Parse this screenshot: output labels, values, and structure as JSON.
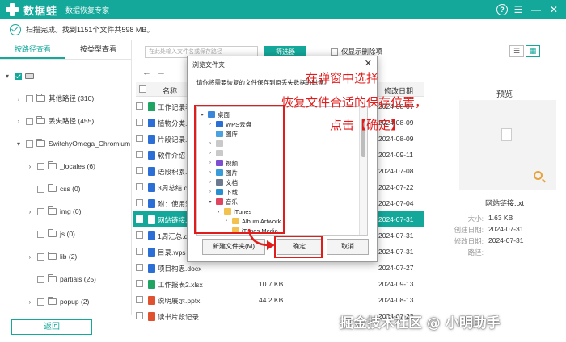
{
  "app": {
    "name": "数据蛙",
    "subtitle": "数据恢复专家"
  },
  "scan": {
    "status": "扫描完成。找到1151个文件共598 MB。"
  },
  "left_panel": {
    "tabs": [
      {
        "label": "按路径查看",
        "active": true
      },
      {
        "label": "按类型查看",
        "active": false
      }
    ],
    "tree": [
      {
        "label": "",
        "indent": 0,
        "caret": "▾",
        "drive": true,
        "checked": true
      },
      {
        "label": "其他路径 (310)",
        "indent": 1,
        "caret": "›"
      },
      {
        "label": "丢失路径 (455)",
        "indent": 1,
        "caret": "›"
      },
      {
        "label": "SwitchyOmega_Chromium",
        "indent": 1,
        "caret": "▾"
      },
      {
        "label": "_locales (6)",
        "indent": 2,
        "caret": "›"
      },
      {
        "label": "css (0)",
        "indent": 2,
        "caret": ""
      },
      {
        "label": "img (0)",
        "indent": 2,
        "caret": "›"
      },
      {
        "label": "js (0)",
        "indent": 2,
        "caret": ""
      },
      {
        "label": "lib (2)",
        "indent": 2,
        "caret": "›"
      },
      {
        "label": "partials (25)",
        "indent": 2,
        "caret": ""
      },
      {
        "label": "popup (2)",
        "indent": 2,
        "caret": "›"
      }
    ]
  },
  "toolbar": {
    "search_placeholder": "在此处输入文件名或保存路径",
    "filter_label": "筛选器",
    "only_deleted_label": "仅显示删除项"
  },
  "columns": {
    "name": "名称",
    "date": "修改日期"
  },
  "files": [
    {
      "name": "工作记录表",
      "size": "",
      "date": "2024-08-07",
      "color": "#1fa463"
    },
    {
      "name": "植物分类.d",
      "size": "",
      "date": "2024-08-09",
      "color": "#2b6fd6"
    },
    {
      "name": "片段记录.d",
      "size": "",
      "date": "2024-08-09",
      "color": "#2b6fd6"
    },
    {
      "name": "软件介绍 -",
      "size": "",
      "date": "2024-09-11",
      "color": "#2b6fd6"
    },
    {
      "name": "语段积累.d",
      "size": "",
      "date": "2024-07-08",
      "color": "#2b6fd6"
    },
    {
      "name": "3周总结.do",
      "size": "",
      "date": "2024-07-22",
      "color": "#2b6fd6"
    },
    {
      "name": "附：使用注",
      "size": "",
      "date": "2024-07-04",
      "color": "#2b6fd6"
    },
    {
      "name": "网站链接.t",
      "size": "",
      "date": "2024-07-31",
      "color": "#ffffff",
      "selected": true
    },
    {
      "name": "1周汇总.do",
      "size": "",
      "date": "2024-07-31",
      "color": "#2b6fd6"
    },
    {
      "name": "目录.wps",
      "size": "",
      "date": "2024-07-31",
      "color": "#2b6fd6"
    },
    {
      "name": "项目构思.docx",
      "size": "",
      "date": "2024-07-27",
      "color": "#2b6fd6"
    },
    {
      "name": "工作报表2.xlsx",
      "size": "10.7 KB",
      "date": "2024-09-13",
      "color": "#1fa463"
    },
    {
      "name": "说明展示.pptx",
      "size": "44.2 KB",
      "date": "2024-08-13",
      "color": "#e0512f"
    },
    {
      "name": "读书片段记录",
      "size": "",
      "date": "2024-07-23",
      "color": "#e0512f"
    }
  ],
  "preview": {
    "title": "预览",
    "file_name": "网站链接.txt",
    "meta": [
      {
        "label": "大小:",
        "value": "1.63 KB"
      },
      {
        "label": "创建日期:",
        "value": "2024-07-31"
      },
      {
        "label": "修改日期:",
        "value": "2024-07-31"
      },
      {
        "label": "路径:",
        "value": ""
      }
    ]
  },
  "bottom": {
    "back_label": "返回"
  },
  "dialog": {
    "title": "浏览文件夹",
    "prompt": "请你将需要恢复的文件保存到原丢失数据的磁盘。",
    "tree": [
      {
        "label": "桌面",
        "indent": 0,
        "caret": "▾",
        "icon": "#3a86d9"
      },
      {
        "label": "WPS云盘",
        "indent": 1,
        "caret": "›",
        "icon": "#2b6fd6"
      },
      {
        "label": "图库",
        "indent": 1,
        "caret": "",
        "icon": "#4aa3e0"
      },
      {
        "label": "",
        "indent": 1,
        "caret": "›",
        "icon": "#c9c9c9"
      },
      {
        "label": "",
        "indent": 1,
        "caret": "›",
        "icon": "#c9c9c9"
      },
      {
        "label": "视频",
        "indent": 1,
        "caret": "›",
        "icon": "#7b4fcf"
      },
      {
        "label": "图片",
        "indent": 1,
        "caret": "›",
        "icon": "#3a9bd9"
      },
      {
        "label": "文档",
        "indent": 1,
        "caret": "›",
        "icon": "#6b7a8f"
      },
      {
        "label": "下载",
        "indent": 1,
        "caret": "›",
        "icon": "#2a8fd0"
      },
      {
        "label": "音乐",
        "indent": 1,
        "caret": "▾",
        "icon": "#e0455f"
      },
      {
        "label": "iTunes",
        "indent": 2,
        "caret": "▾",
        "icon": "#f2c14e"
      },
      {
        "label": "Album Artwork",
        "indent": 3,
        "caret": "›",
        "icon": "#f2c14e"
      },
      {
        "label": "iTunes Media",
        "indent": 3,
        "caret": "",
        "icon": "#f2c14e"
      }
    ],
    "new_folder_label": "新建文件夹(M)",
    "ok_label": "确定",
    "cancel_label": "取消"
  },
  "annotation": {
    "lines": [
      "在弹窗中选择",
      "恢复文件合适的保存位置，",
      "点击【确定】"
    ]
  },
  "watermark": "掘金技术社区 @ 小明助手"
}
